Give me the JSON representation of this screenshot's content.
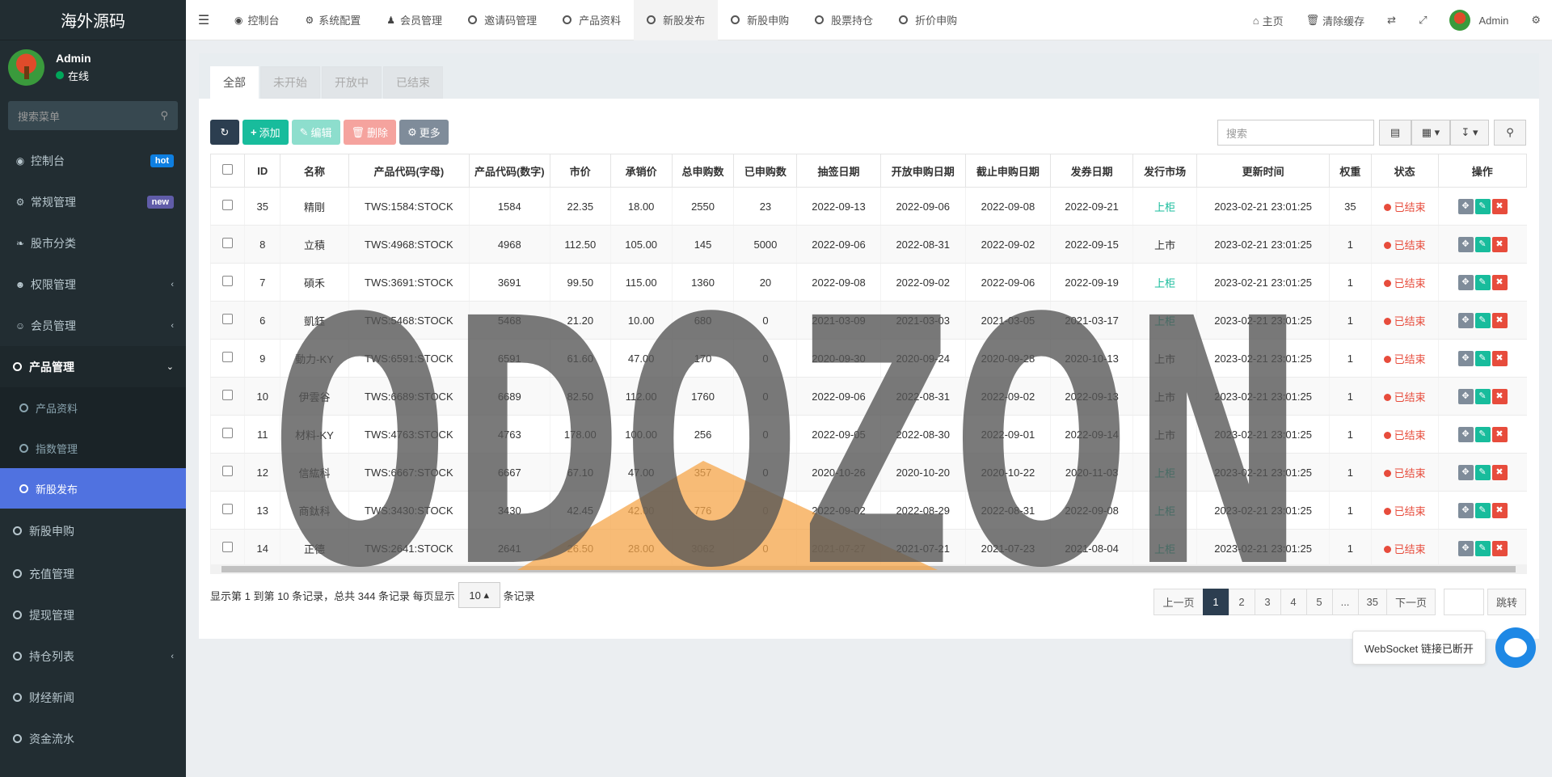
{
  "brand": "海外源码",
  "user": {
    "name": "Admin",
    "status": "在线"
  },
  "sidebar": {
    "search_placeholder": "搜索菜单",
    "items": [
      {
        "label": "控制台",
        "icon": "dashboard-icon",
        "badge": "hot"
      },
      {
        "label": "常规管理",
        "icon": "cogs-icon",
        "badge": "new"
      },
      {
        "label": "股市分类",
        "icon": "leaf-icon"
      },
      {
        "label": "权限管理",
        "icon": "group-icon"
      },
      {
        "label": "会员管理",
        "icon": "user-circle-icon"
      },
      {
        "label": "产品管理",
        "icon": "circle-o-icon"
      }
    ],
    "subitems": [
      {
        "label": "产品资料"
      },
      {
        "label": "指数管理"
      },
      {
        "label": "新股发布"
      }
    ],
    "items_after": [
      {
        "label": "新股申购"
      },
      {
        "label": "充值管理"
      },
      {
        "label": "提现管理"
      },
      {
        "label": "持仓列表"
      },
      {
        "label": "财经新闻"
      },
      {
        "label": "资金流水"
      }
    ]
  },
  "topnav": {
    "tabs": [
      "控制台",
      "系统配置",
      "会员管理",
      "邀请码管理",
      "产品资料",
      "新股发布",
      "新股申购",
      "股票持仓",
      "折价申购"
    ],
    "active_tab": "新股发布",
    "home": "主页",
    "clear_cache": "清除缓存",
    "admin": "Admin"
  },
  "filter_tabs": [
    "全部",
    "未开始",
    "开放中",
    "已结束"
  ],
  "toolbar": {
    "add": "添加",
    "edit": "编辑",
    "delete": "删除",
    "more": "更多",
    "search_placeholder": "搜索"
  },
  "table": {
    "headers": [
      "ID",
      "名称",
      "产品代码(字母)",
      "产品代码(数字)",
      "市价",
      "承销价",
      "总申购数",
      "已申购数",
      "抽签日期",
      "开放申购日期",
      "截止申购日期",
      "发券日期",
      "发行市场",
      "更新时间",
      "权重",
      "状态",
      "操作"
    ],
    "rows": [
      [
        "35",
        "精剛",
        "TWS:1584:STOCK",
        "1584",
        "22.35",
        "18.00",
        "2550",
        "23",
        "2022-09-13",
        "2022-09-06",
        "2022-09-08",
        "2022-09-21",
        "上柜",
        "2023-02-21 23:01:25",
        "35",
        "已结束"
      ],
      [
        "8",
        "立積",
        "TWS:4968:STOCK",
        "4968",
        "112.50",
        "105.00",
        "145",
        "5000",
        "2022-09-06",
        "2022-08-31",
        "2022-09-02",
        "2022-09-15",
        "上市",
        "2023-02-21 23:01:25",
        "1",
        "已结束"
      ],
      [
        "7",
        "碩禾",
        "TWS:3691:STOCK",
        "3691",
        "99.50",
        "115.00",
        "1360",
        "20",
        "2022-09-08",
        "2022-09-02",
        "2022-09-06",
        "2022-09-19",
        "上柜",
        "2023-02-21 23:01:25",
        "1",
        "已结束"
      ],
      [
        "6",
        "凱鈺",
        "TWS:5468:STOCK",
        "5468",
        "21.20",
        "10.00",
        "680",
        "0",
        "2021-03-09",
        "2021-03-03",
        "2021-03-05",
        "2021-03-17",
        "上柜",
        "2023-02-21 23:01:25",
        "1",
        "已结束"
      ],
      [
        "9",
        "動力-KY",
        "TWS:6591:STOCK",
        "6591",
        "61.60",
        "47.00",
        "170",
        "0",
        "2020-09-30",
        "2020-09-24",
        "2020-09-28",
        "2020-10-13",
        "上市",
        "2023-02-21 23:01:25",
        "1",
        "已结束"
      ],
      [
        "10",
        "伊雲谷",
        "TWS:6689:STOCK",
        "6689",
        "82.50",
        "112.00",
        "1760",
        "0",
        "2022-09-06",
        "2022-08-31",
        "2022-09-02",
        "2022-09-13",
        "上市",
        "2023-02-21 23:01:25",
        "1",
        "已结束"
      ],
      [
        "11",
        "材料-KY",
        "TWS:4763:STOCK",
        "4763",
        "178.00",
        "100.00",
        "256",
        "0",
        "2022-09-05",
        "2022-08-30",
        "2022-09-01",
        "2022-09-14",
        "上市",
        "2023-02-21 23:01:25",
        "1",
        "已结束"
      ],
      [
        "12",
        "信紘科",
        "TWS:6667:STOCK",
        "6667",
        "67.10",
        "47.00",
        "357",
        "0",
        "2020-10-26",
        "2020-10-20",
        "2020-10-22",
        "2020-11-03",
        "上柜",
        "2023-02-21 23:01:25",
        "1",
        "已结束"
      ],
      [
        "13",
        "商鈦科",
        "TWS:3430:STOCK",
        "3430",
        "42.45",
        "42.00",
        "776",
        "0",
        "2022-09-02",
        "2022-08-29",
        "2022-08-31",
        "2022-09-08",
        "上柜",
        "2023-02-21 23:01:25",
        "1",
        "已结束"
      ],
      [
        "14",
        "正德",
        "TWS:2641:STOCK",
        "2641",
        "26.50",
        "28.00",
        "3062",
        "0",
        "2021-07-27",
        "2021-07-21",
        "2021-07-23",
        "2021-08-04",
        "上柜",
        "2023-02-21 23:01:25",
        "1",
        "已结束"
      ]
    ]
  },
  "pagination": {
    "info_prefix": "显示第 1 到第 10 条记录，总共 344 条记录 每页显示",
    "page_size": "10",
    "info_suffix": "条记录",
    "prev": "上一页",
    "pages": [
      "1",
      "2",
      "3",
      "4",
      "5",
      "...",
      "35"
    ],
    "next": "下一页",
    "jump": "跳转"
  },
  "websocket_tip": "WebSocket 链接已断开",
  "watermark": "ODOZON",
  "colors": {
    "accent": "#5072e0",
    "sidebar_bg": "#222d32",
    "success": "#18bc9c",
    "danger": "#e74c3c"
  }
}
